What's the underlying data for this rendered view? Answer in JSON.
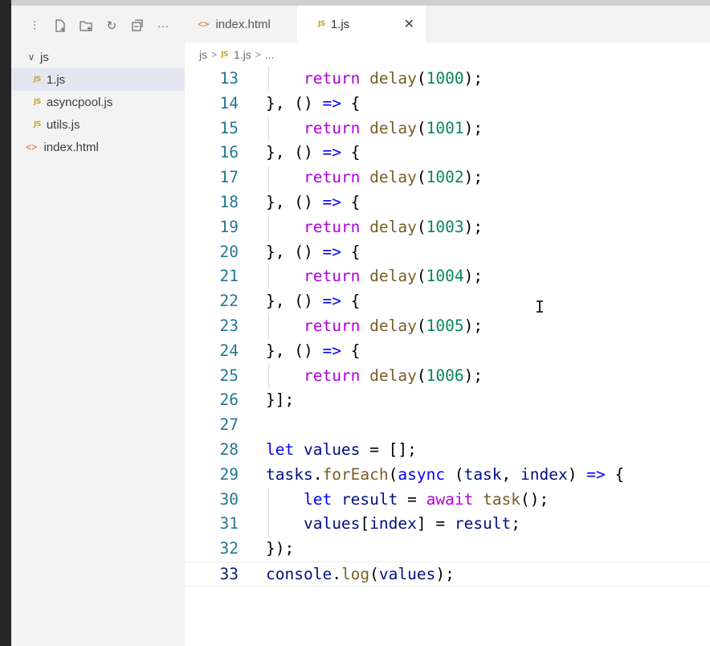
{
  "sidebar": {
    "toolbar_icons": [
      "collapse-icon",
      "new-file-icon",
      "new-folder-icon",
      "refresh-icon",
      "collapse-all-icon",
      "more-icon"
    ],
    "folder": "js",
    "files": [
      {
        "name": "1.js",
        "type": "js",
        "selected": true
      },
      {
        "name": "asyncpool.js",
        "type": "js",
        "selected": false
      },
      {
        "name": "utils.js",
        "type": "js",
        "selected": false
      }
    ],
    "root_file": {
      "name": "index.html",
      "type": "html"
    }
  },
  "tabs": [
    {
      "label": "index.html",
      "icon": "<>",
      "active": false
    },
    {
      "label": "1.js",
      "icon": "JS",
      "active": true
    }
  ],
  "tab_close": "✕",
  "breadcrumb": {
    "folder": "js",
    "file": "1.js",
    "more": "..."
  },
  "editor": {
    "current_line": 33,
    "lines": [
      {
        "n": "13",
        "indent": 1,
        "tokens": [
          [
            "k",
            "return "
          ],
          [
            "f",
            "delay"
          ],
          [
            "p",
            "("
          ],
          [
            "n",
            "1000"
          ],
          [
            "p",
            ");"
          ]
        ]
      },
      {
        "n": "14",
        "indent": 0,
        "tokens": [
          [
            "p",
            "}, () "
          ],
          [
            "b",
            "=>"
          ],
          [
            "p",
            " {"
          ]
        ]
      },
      {
        "n": "15",
        "indent": 1,
        "tokens": [
          [
            "k",
            "return "
          ],
          [
            "f",
            "delay"
          ],
          [
            "p",
            "("
          ],
          [
            "n",
            "1001"
          ],
          [
            "p",
            ");"
          ]
        ]
      },
      {
        "n": "16",
        "indent": 0,
        "tokens": [
          [
            "p",
            "}, () "
          ],
          [
            "b",
            "=>"
          ],
          [
            "p",
            " {"
          ]
        ]
      },
      {
        "n": "17",
        "indent": 1,
        "tokens": [
          [
            "k",
            "return "
          ],
          [
            "f",
            "delay"
          ],
          [
            "p",
            "("
          ],
          [
            "n",
            "1002"
          ],
          [
            "p",
            ");"
          ]
        ]
      },
      {
        "n": "18",
        "indent": 0,
        "tokens": [
          [
            "p",
            "}, () "
          ],
          [
            "b",
            "=>"
          ],
          [
            "p",
            " {"
          ]
        ]
      },
      {
        "n": "19",
        "indent": 1,
        "tokens": [
          [
            "k",
            "return "
          ],
          [
            "f",
            "delay"
          ],
          [
            "p",
            "("
          ],
          [
            "n",
            "1003"
          ],
          [
            "p",
            ");"
          ]
        ]
      },
      {
        "n": "20",
        "indent": 0,
        "tokens": [
          [
            "p",
            "}, () "
          ],
          [
            "b",
            "=>"
          ],
          [
            "p",
            " {"
          ]
        ]
      },
      {
        "n": "21",
        "indent": 1,
        "tokens": [
          [
            "k",
            "return "
          ],
          [
            "f",
            "delay"
          ],
          [
            "p",
            "("
          ],
          [
            "n",
            "1004"
          ],
          [
            "p",
            ");"
          ]
        ]
      },
      {
        "n": "22",
        "indent": 0,
        "tokens": [
          [
            "p",
            "}, () "
          ],
          [
            "b",
            "=>"
          ],
          [
            "p",
            " {"
          ]
        ]
      },
      {
        "n": "23",
        "indent": 1,
        "tokens": [
          [
            "k",
            "return "
          ],
          [
            "f",
            "delay"
          ],
          [
            "p",
            "("
          ],
          [
            "n",
            "1005"
          ],
          [
            "p",
            ");"
          ]
        ]
      },
      {
        "n": "24",
        "indent": 0,
        "tokens": [
          [
            "p",
            "}, () "
          ],
          [
            "b",
            "=>"
          ],
          [
            "p",
            " {"
          ]
        ]
      },
      {
        "n": "25",
        "indent": 1,
        "tokens": [
          [
            "k",
            "return "
          ],
          [
            "f",
            "delay"
          ],
          [
            "p",
            "("
          ],
          [
            "n",
            "1006"
          ],
          [
            "p",
            ");"
          ]
        ]
      },
      {
        "n": "26",
        "indent": 0,
        "tokens": [
          [
            "p",
            "}];"
          ]
        ]
      },
      {
        "n": "27",
        "indent": 0,
        "tokens": []
      },
      {
        "n": "28",
        "indent": 0,
        "tokens": [
          [
            "b",
            "let "
          ],
          [
            "v",
            "values"
          ],
          [
            "p",
            " = [];"
          ]
        ]
      },
      {
        "n": "29",
        "indent": 0,
        "tokens": [
          [
            "v",
            "tasks"
          ],
          [
            "p",
            "."
          ],
          [
            "f",
            "forEach"
          ],
          [
            "p",
            "("
          ],
          [
            "b",
            "async"
          ],
          [
            "p",
            " ("
          ],
          [
            "v",
            "task"
          ],
          [
            "p",
            ", "
          ],
          [
            "v",
            "index"
          ],
          [
            "p",
            ") "
          ],
          [
            "b",
            "=>"
          ],
          [
            "p",
            " {"
          ]
        ]
      },
      {
        "n": "30",
        "indent": 1,
        "tokens": [
          [
            "b",
            "let "
          ],
          [
            "v",
            "result"
          ],
          [
            "p",
            " = "
          ],
          [
            "k",
            "await "
          ],
          [
            "f",
            "task"
          ],
          [
            "p",
            "();"
          ]
        ]
      },
      {
        "n": "31",
        "indent": 1,
        "tokens": [
          [
            "v",
            "values"
          ],
          [
            "p",
            "["
          ],
          [
            "v",
            "index"
          ],
          [
            "p",
            "] = "
          ],
          [
            "v",
            "result"
          ],
          [
            "p",
            ";"
          ]
        ]
      },
      {
        "n": "32",
        "indent": 0,
        "tokens": [
          [
            "p",
            "});"
          ]
        ]
      },
      {
        "n": "33",
        "indent": 0,
        "tokens": [
          [
            "v",
            "console"
          ],
          [
            "p",
            "."
          ],
          [
            "f",
            "log"
          ],
          [
            "p",
            "("
          ],
          [
            "v",
            "values"
          ],
          [
            "p",
            ");"
          ]
        ]
      }
    ]
  }
}
